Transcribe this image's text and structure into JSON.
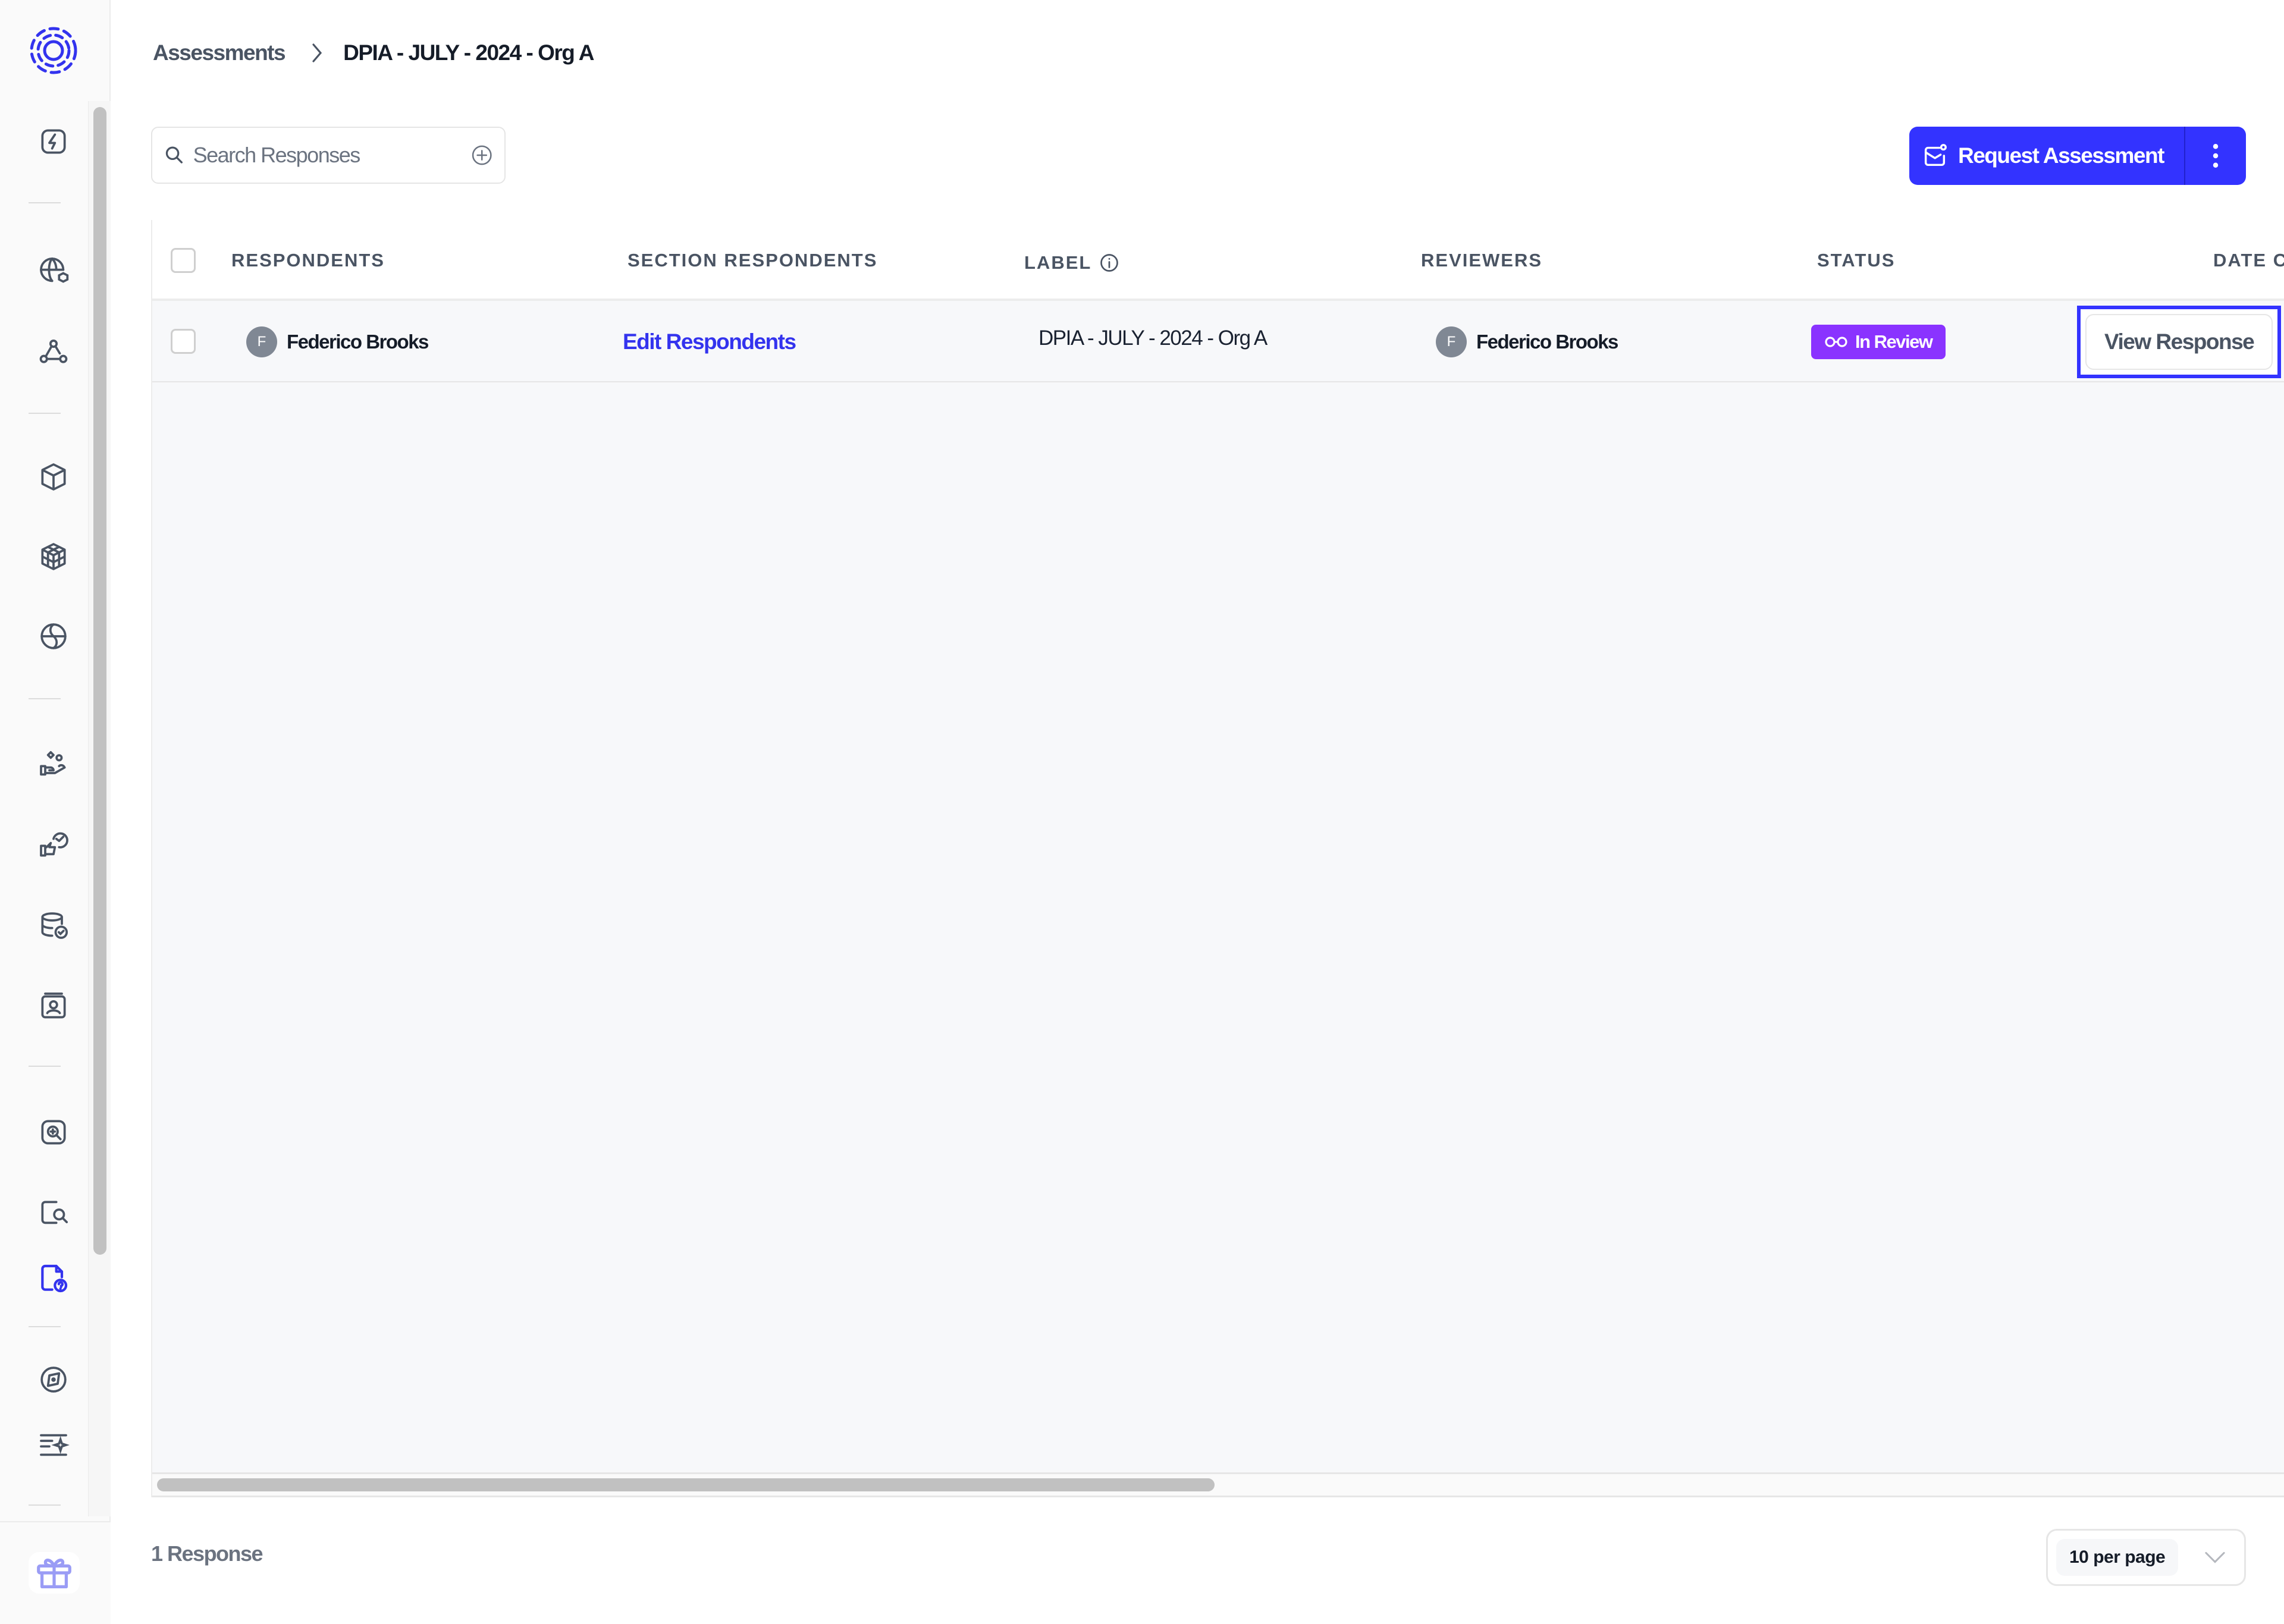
{
  "sidebar": {
    "logo": "privacy-logo",
    "items": [
      {
        "icon": "lightning-icon",
        "active": false
      },
      {
        "icon": "globe-cube-icon",
        "active": false
      },
      {
        "icon": "network-nodes-icon",
        "active": false
      },
      {
        "icon": "cube-icon",
        "active": false
      },
      {
        "icon": "cubes-grid-icon",
        "active": false
      },
      {
        "icon": "globe-orbit-icon",
        "active": false
      },
      {
        "icon": "hand-people-icon",
        "active": false
      },
      {
        "icon": "thumbs-up-check-icon",
        "active": false
      },
      {
        "icon": "database-check-icon",
        "active": false
      },
      {
        "icon": "contact-card-icon",
        "active": false
      },
      {
        "icon": "zoom-in-box-icon",
        "active": false
      },
      {
        "icon": "document-search-icon",
        "active": false
      },
      {
        "icon": "document-question-icon",
        "active": true
      },
      {
        "icon": "compass-icon",
        "active": false
      },
      {
        "icon": "list-sparkle-icon",
        "active": false
      }
    ],
    "bottom_icon": "gift-icon"
  },
  "breadcrumb": {
    "parent": "Assessments",
    "current": "DPIA - JULY - 2024 - Org A"
  },
  "search": {
    "placeholder": "Search Responses",
    "value": ""
  },
  "toolbar": {
    "request_label": "Request Assessment",
    "more_icon": "kebab-menu-icon"
  },
  "colors": {
    "accent": "#3333ff",
    "status_in_review": "#8a33ff"
  },
  "table": {
    "columns": [
      {
        "key": "respondents",
        "label": "RESPONDENTS"
      },
      {
        "key": "section_respondents",
        "label": "SECTION RESPONDENTS"
      },
      {
        "key": "label",
        "label": "LABEL",
        "info_icon": true
      },
      {
        "key": "reviewers",
        "label": "REVIEWERS"
      },
      {
        "key": "status",
        "label": "STATUS"
      },
      {
        "key": "date",
        "label": "DATE C"
      }
    ],
    "rows": [
      {
        "respondent": {
          "initial": "F",
          "name": "Federico Brooks"
        },
        "section_respondents_link": "Edit Respondents",
        "label": "DPIA - JULY - 2024 - Org A",
        "reviewer": {
          "initial": "F",
          "name": "Federico Brooks"
        },
        "status": "In Review",
        "action": "View Response"
      }
    ]
  },
  "footer": {
    "count": "1 Response",
    "per_page": "10 per page"
  }
}
